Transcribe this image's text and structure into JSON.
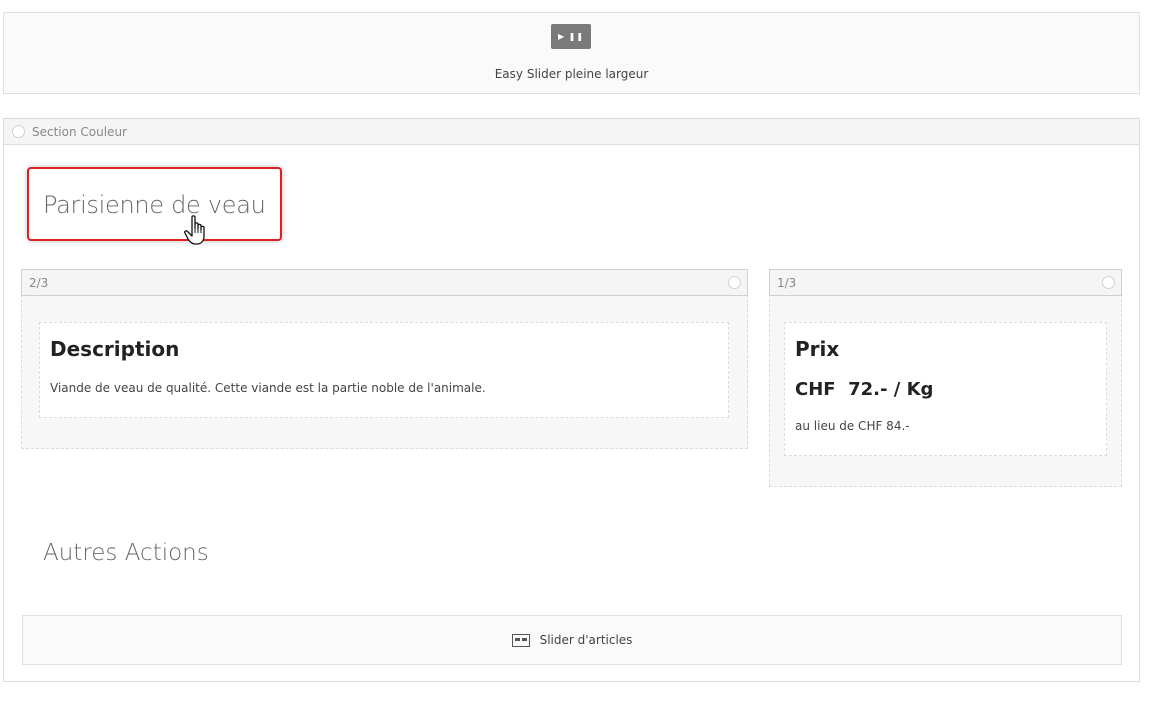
{
  "slider_module": {
    "label": "Easy Slider pleine largeur",
    "icon": "play-pause-icon",
    "icon_glyph": "▶ ❚❚"
  },
  "section": {
    "label": "Section Couleur",
    "title": "Parisienne de veau",
    "columns": [
      {
        "width_label": "2/3",
        "heading": "Description",
        "text": "Viande de veau de qualité. Cette viande est la partie noble de l'animale."
      },
      {
        "width_label": "1/3",
        "heading": "Prix",
        "price": "CHF  72.- / Kg",
        "text": "au lieu de CHF 84.-"
      }
    ],
    "subtitle": "Autres Actions",
    "articles_module": {
      "label": "Slider d'articles",
      "icon": "layout-icon"
    }
  },
  "colors": {
    "highlight": "#e02020",
    "module_icon_bg": "#7a7a7a"
  }
}
